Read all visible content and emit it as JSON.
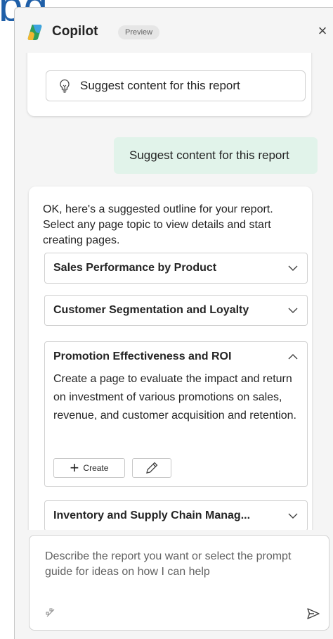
{
  "background": {
    "title_fragment": "pg"
  },
  "header": {
    "title": "Copilot",
    "badge": "Preview",
    "close_glyph": "×",
    "logo_icon": "copilot-logo"
  },
  "chat": {
    "suggest_button": {
      "label": "Suggest content for this report",
      "icon": "lightbulb-icon"
    },
    "user_message": "Suggest content for this report",
    "reply": {
      "intro": "OK, here's a suggested outline for your report. Select any page topic to view details and start creating pages.",
      "topics": [
        {
          "label": "Sales Performance by Product",
          "expanded": false
        },
        {
          "label": "Customer Segmentation and Loyalty",
          "expanded": false
        },
        {
          "label": "Promotion Effectiveness and ROI",
          "expanded": true,
          "description": "Create a page to evaluate the impact and return on investment of various promotions on sales, revenue, and customer acquisition and retention.",
          "create_label": "Create"
        },
        {
          "label": "Inventory and Supply Chain Manag...",
          "expanded": false
        }
      ]
    }
  },
  "input": {
    "placeholder": "Describe the report you want or select the prompt guide for ideas on how I can help",
    "prompt_guide_icon": "prompt-guide-icon",
    "send_icon": "send-icon"
  },
  "colors": {
    "user_bubble": "#e1f3ea",
    "panel_bg": "#f5f5f5",
    "accent_blue": "#1f5fa8"
  }
}
